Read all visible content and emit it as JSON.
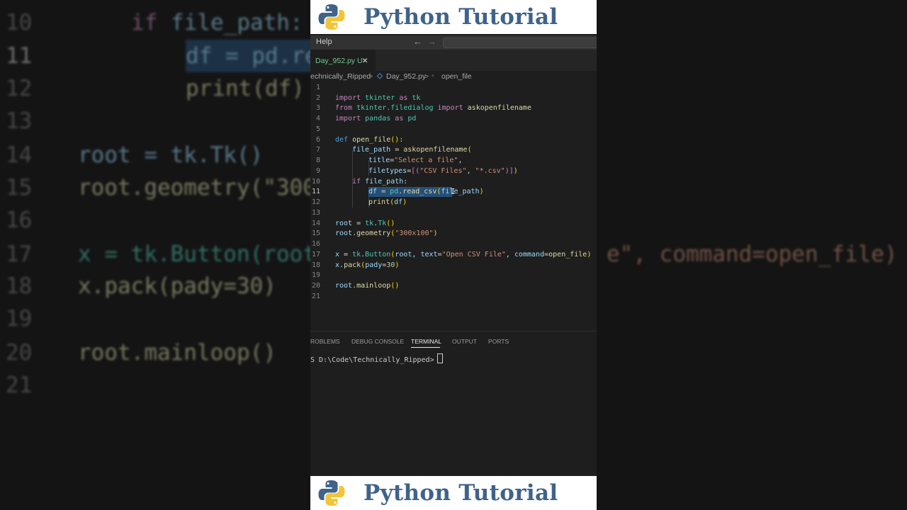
{
  "banner": {
    "title": "Python Tutorial"
  },
  "menubar": {
    "help": "Help",
    "back_icon": "←",
    "forward_icon": "→"
  },
  "tab": {
    "filename": "Day_952.py",
    "status": "U",
    "close": "×"
  },
  "breadcrumb": {
    "folder": "echnically_Ripped",
    "sep": ">",
    "file": "Day_952.py",
    "symbol": "open_file"
  },
  "editor": {
    "line_numbers": [
      "1",
      "2",
      "3",
      "4",
      "5",
      "6",
      "7",
      "8",
      "9",
      "10",
      "11",
      "12",
      "13",
      "14",
      "15",
      "16",
      "17",
      "18",
      "19",
      "20",
      "21"
    ],
    "code": {
      "l2": {
        "a": "import",
        "b": " tkinter ",
        "c": "as",
        "d": " tk"
      },
      "l3": {
        "a": "from",
        "b": " tkinter.filedialog ",
        "c": "import",
        "d": " askopenfilename"
      },
      "l4": {
        "a": "import",
        "b": " pandas ",
        "c": "as",
        "d": " pd"
      },
      "l6": {
        "a": "def",
        "b": " open_file",
        "c": "():"
      },
      "l7": {
        "a": "file_path",
        "b": " = ",
        "c": "askopenfilename",
        "d": "("
      },
      "l8": {
        "a": "title",
        "b": "=",
        "c": "\"Select a file\"",
        "d": ","
      },
      "l9": {
        "a": "filetypes",
        "b": "=",
        "c": "[(",
        "d": "\"CSV Files\"",
        "e": ", ",
        "f": "\"*.csv\"",
        "g": ")]",
        "h": ")"
      },
      "l10": {
        "a": "if",
        "b": " file_path",
        ":": ":"
      },
      "l11": {
        "a": "df",
        "b": " = ",
        "c": "pd",
        "d": ".",
        "e": "read_csv",
        "f": "(",
        "g": "file_path",
        "h": ")"
      },
      "l12": {
        "a": "print",
        "b": "(",
        "c": "df",
        "d": ")"
      },
      "l14": {
        "a": "root",
        "b": " = ",
        "c": "tk",
        "d": ".",
        "e": "Tk",
        "f": "()"
      },
      "l15": {
        "a": "root",
        "b": ".",
        "c": "geometry",
        "d": "(",
        "e": "\"300x100\"",
        "f": ")"
      },
      "l17": {
        "a": "x",
        "b": " = ",
        "c": "tk",
        "d": ".",
        "e": "Button",
        "f": "(",
        "g": "root",
        ",": ", ",
        "h": "text",
        "i": "=",
        "j": "\"Open CSV File\"",
        "k": ", ",
        "l": "command",
        "m": "=",
        "n": "open_file",
        "o": ")"
      },
      "l18": {
        "a": "x",
        "b": ".",
        "c": "pack",
        "d": "(",
        "e": "pady",
        "f": "=",
        "g": "30",
        "h": ")"
      },
      "l20": {
        "a": "root",
        "b": ".",
        "c": "mainloop",
        "d": "()"
      }
    }
  },
  "panel_tabs": [
    "PROBLEMS",
    "DEBUG CONSOLE",
    "TERMINAL",
    "OUTPUT",
    "PORTS"
  ],
  "panel_tabs_visible": [
    "ROBLEMS",
    "DEBUG CONSOLE",
    "TERMINAL",
    "OUTPUT",
    "PORTS"
  ],
  "active_panel_tab": "TERMINAL",
  "terminal": {
    "prompt": "S D:\\Code\\Technically_Ripped>"
  },
  "background": {
    "lines": [
      {
        "n": "10",
        "t": "    if file_path:"
      },
      {
        "n": "11",
        "t": "        df = pd.re"
      },
      {
        "n": "12",
        "t": "        print(df)"
      },
      {
        "n": "13",
        "t": ""
      },
      {
        "n": "14",
        "t": "root = tk.Tk()"
      },
      {
        "n": "15",
        "t": "root.geometry(\"300"
      },
      {
        "n": "16",
        "t": ""
      },
      {
        "n": "17",
        "t": "x = tk.Button(root"
      },
      {
        "n": "18",
        "t": "x.pack(pady=30)"
      },
      {
        "n": "19",
        "t": ""
      },
      {
        "n": "20",
        "t": "root.mainloop()"
      },
      {
        "n": "21",
        "t": ""
      }
    ],
    "right_fragment": "e\", command=open_file)"
  },
  "colors": {
    "accent": "#3f6389",
    "editor_bg": "#1e1e1e",
    "selection": "#264f78"
  }
}
